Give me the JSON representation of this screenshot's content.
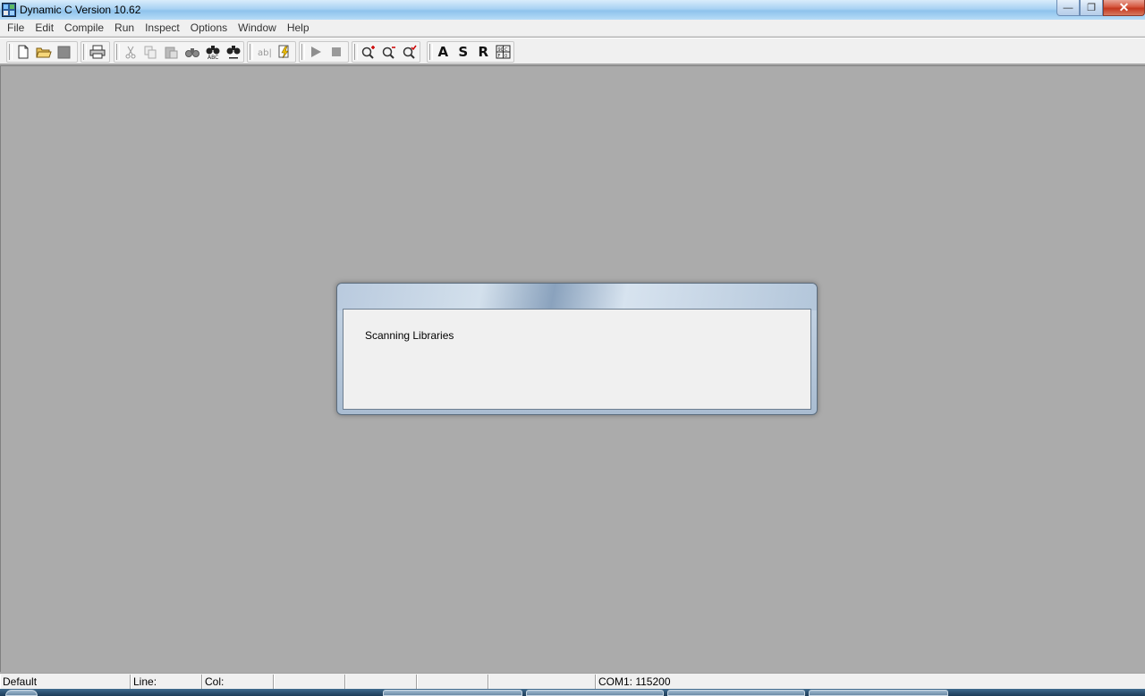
{
  "window": {
    "title": "Dynamic C Version 10.62",
    "controls": {
      "minimize": "—",
      "restore": "❐",
      "close": "✕"
    }
  },
  "menu": {
    "items": [
      "File",
      "Edit",
      "Compile",
      "Run",
      "Inspect",
      "Options",
      "Window",
      "Help"
    ]
  },
  "toolbar": {
    "icons": [
      "new-file-icon",
      "open-folder-icon",
      "save-icon",
      "print-icon",
      "cut-icon",
      "copy-icon",
      "paste-icon",
      "find-icon",
      "find-next-icon",
      "replace-icon",
      "spell-icon",
      "compile-lightning-icon",
      "run-icon",
      "stop-icon",
      "zoom-in-icon",
      "zoom-out-icon",
      "zoom-check-icon"
    ],
    "letters": {
      "a": "A",
      "s": "S",
      "r": "R"
    }
  },
  "dialog": {
    "message": "Scanning Libraries"
  },
  "statusbar": {
    "mode": "Default",
    "line_label": "Line:",
    "col_label": "Col:",
    "com_port": "COM1: 115200"
  },
  "colors": {
    "client_background": "#ababab",
    "chrome": "#f0f0f0",
    "title_gradient": "#a9d2f3"
  }
}
